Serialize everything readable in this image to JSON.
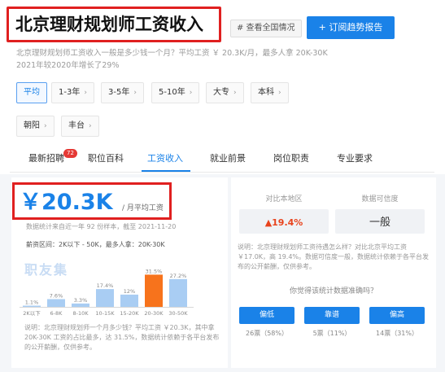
{
  "header": {
    "title": "北京理财规划师工资收入",
    "tag_button": "# 查看全国情况",
    "subscribe_button": "+ 订阅趋势报告",
    "description_line1": "北京理财规划师工资收入一般是多少钱一个月？平均工资 ￥ 20.3K/月，最多人拿 20K-30K",
    "description_line2": "2021年较2020年增长了29%"
  },
  "filters": {
    "row1": [
      {
        "label": "平均",
        "active": true,
        "chevron": false
      },
      {
        "label": "1-3年",
        "active": false,
        "chevron": true
      },
      {
        "label": "3-5年",
        "active": false,
        "chevron": true
      },
      {
        "label": "5-10年",
        "active": false,
        "chevron": true
      },
      {
        "label": "大专",
        "active": false,
        "chevron": true
      },
      {
        "label": "本科",
        "active": false,
        "chevron": true
      }
    ],
    "row2": [
      {
        "label": "朝阳",
        "active": false,
        "chevron": true
      },
      {
        "label": "丰台",
        "active": false,
        "chevron": true
      }
    ],
    "chevron_glyph": "›"
  },
  "tabs": {
    "items": [
      "最新招聘",
      "职位百科",
      "工资收入",
      "就业前景",
      "岗位职责",
      "专业要求"
    ],
    "active_index": 2,
    "badge": "72"
  },
  "salary": {
    "value": "￥20.3K",
    "unit": "/ 月平均工资",
    "stats_note": "数据统计来自近一年 92 份样本，截至 2021-11-20",
    "range_note": "薪资区间：2K以下 - 50K，最多人拿：20K-30K",
    "watermark": "职友集",
    "footer_note": "说明：北京理财规划师一个月多少钱？平均工资 ￥20.3K，其中拿 20K-30K 工资的占比最多，达 31.5%，数据统计依赖于各平台发布的公开薪酬，仅供参考。"
  },
  "chart_data": {
    "type": "bar",
    "categories": [
      "2K以下",
      "6-8K",
      "8-10K",
      "10-15K",
      "15-20K",
      "20-30K",
      "30-50K"
    ],
    "values": [
      1.1,
      7.6,
      3.3,
      17.4,
      12,
      31.5,
      27.2
    ],
    "value_labels": [
      "1.1%",
      "7.6%",
      "3.3%",
      "17.4%",
      "12%",
      "31.5%",
      "27.2%"
    ],
    "highlight_index": 5,
    "colors": {
      "bar": "#a9cdf3",
      "highlight": "#f7731c"
    },
    "ylim": [
      0,
      35
    ]
  },
  "comparison": {
    "left_label": "对比本地区",
    "right_label": "数据可信度",
    "left_value": "▲19.4%",
    "right_value": "一般",
    "note": "说明：北京理财规划师工资待遇怎么样？对比北京平均工资 ￥17.0K，高 19.4%。数据可信度一般，数据统计依赖于各平台发布的公开薪酬，仅供参考。",
    "question": "你觉得该统计数据准确吗？",
    "votes": [
      {
        "label": "偏低",
        "count": "26票（58%）"
      },
      {
        "label": "靠谱",
        "count": "5票（11%）"
      },
      {
        "label": "偏高",
        "count": "14票（31%）"
      }
    ]
  },
  "colors": {
    "accent": "#1a82e8",
    "highlight_red": "#e02020",
    "up_red": "#e8431c"
  }
}
